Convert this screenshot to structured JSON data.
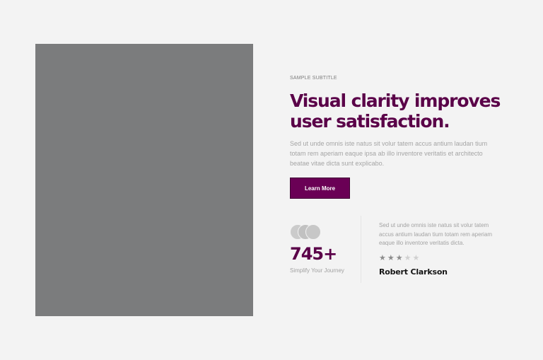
{
  "hero": {
    "subtitle": "SAMPLE SUBTITLE",
    "headline": "Visual clarity improves user satisfaction.",
    "description": "Sed ut unde omnis iste natus sit volur tatem accus antium laudan tium totam rem aperiam eaque ipsa ab illo inventore veritatis et architecto beatae vitae dicta sunt explicabo.",
    "cta_label": "Learn More",
    "image": "placeholder"
  },
  "stats": {
    "number": "745+",
    "label": "Simplify Your Journey",
    "avatars": [
      "avatar",
      "avatar",
      "avatar"
    ]
  },
  "testimonial": {
    "text": "Sed ut unde omnis iste natus sit volur tatem accus antium laudan tium totam rem aperiam eaque illo inventore veritatis dicta.",
    "rating": 3,
    "rating_max": 5,
    "author": "Robert Clarkson"
  },
  "colors": {
    "background": "#f3f3f3",
    "accent": "#6a0055",
    "headline": "#5a0048",
    "placeholder": "#7b7c7d"
  }
}
